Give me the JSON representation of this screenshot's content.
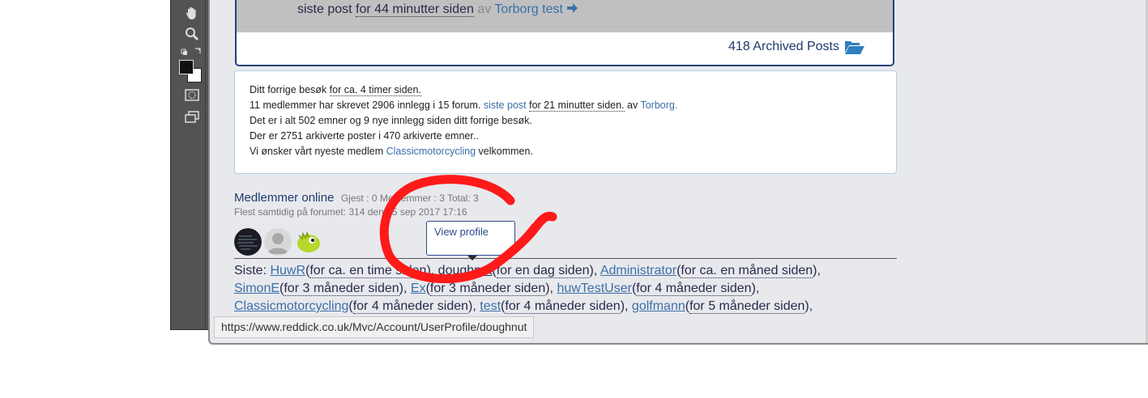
{
  "forum": {
    "last_post_label": "siste post",
    "last_post_time": "for 44 minutter siden",
    "by": "av",
    "author": "Torborg test",
    "archived": "418 Archived Posts"
  },
  "stats": {
    "l1_pre": "Ditt forrige besøk",
    "l1_time": "for ca. 4 timer siden.",
    "l2_pre": "11 medlemmer har skrevet 2906 innlegg i 15 forum.",
    "l2_link": "siste post",
    "l2_time": "for 21 minutter siden.",
    "l2_by": "av",
    "l2_user": "Torborg.",
    "l3": "Det er i alt 502 emner og 9 nye innlegg siden ditt forrige besøk.",
    "l4": "Der er 2751 arkiverte poster i 470 arkiverte emner..",
    "l5_pre": "Vi ønsker vårt nyeste medlem",
    "l5_user": "Classicmotorcycling",
    "l5_post": "velkommen."
  },
  "online": {
    "title": "Medlemmer online",
    "counts": "Gjest : 0 Medlemmer : 3 Total: 3",
    "record": "Flest samtidig på forumet: 314 den 05 sep 2017 17:16"
  },
  "recent": {
    "label": "Siste:",
    "users": [
      {
        "name": "HuwR",
        "time": "for ca. en time siden"
      },
      {
        "name": "doughnut",
        "time": "for en dag siden"
      },
      {
        "name": "Administrator",
        "time": "for ca. en måned siden"
      },
      {
        "name": "SimonE",
        "time": "for 3 måneder siden"
      },
      {
        "name": "Ex",
        "time": "for 3 måneder siden"
      },
      {
        "name": "huwTestUser",
        "time": "for 4 måneder siden"
      },
      {
        "name": "Classicmotorcycling",
        "time": "for 4 måneder siden"
      },
      {
        "name": "test",
        "time": "for 4 måneder siden"
      },
      {
        "name": "golfmann",
        "time": "for 5 måneder siden"
      }
    ]
  },
  "tooltip": {
    "text": "View profile"
  },
  "status": {
    "url": "https://www.reddick.co.uk/Mvc/Account/UserProfile/doughnut"
  },
  "colors": {
    "link": "#3b6fa8",
    "annotation": "#ff1a1a",
    "panel_border": "#22447a"
  },
  "icons": [
    "hand-tool-icon",
    "zoom-tool-icon",
    "swap-colors-icon",
    "quick-mask-icon",
    "screen-mode-icon",
    "folder-open-icon"
  ]
}
